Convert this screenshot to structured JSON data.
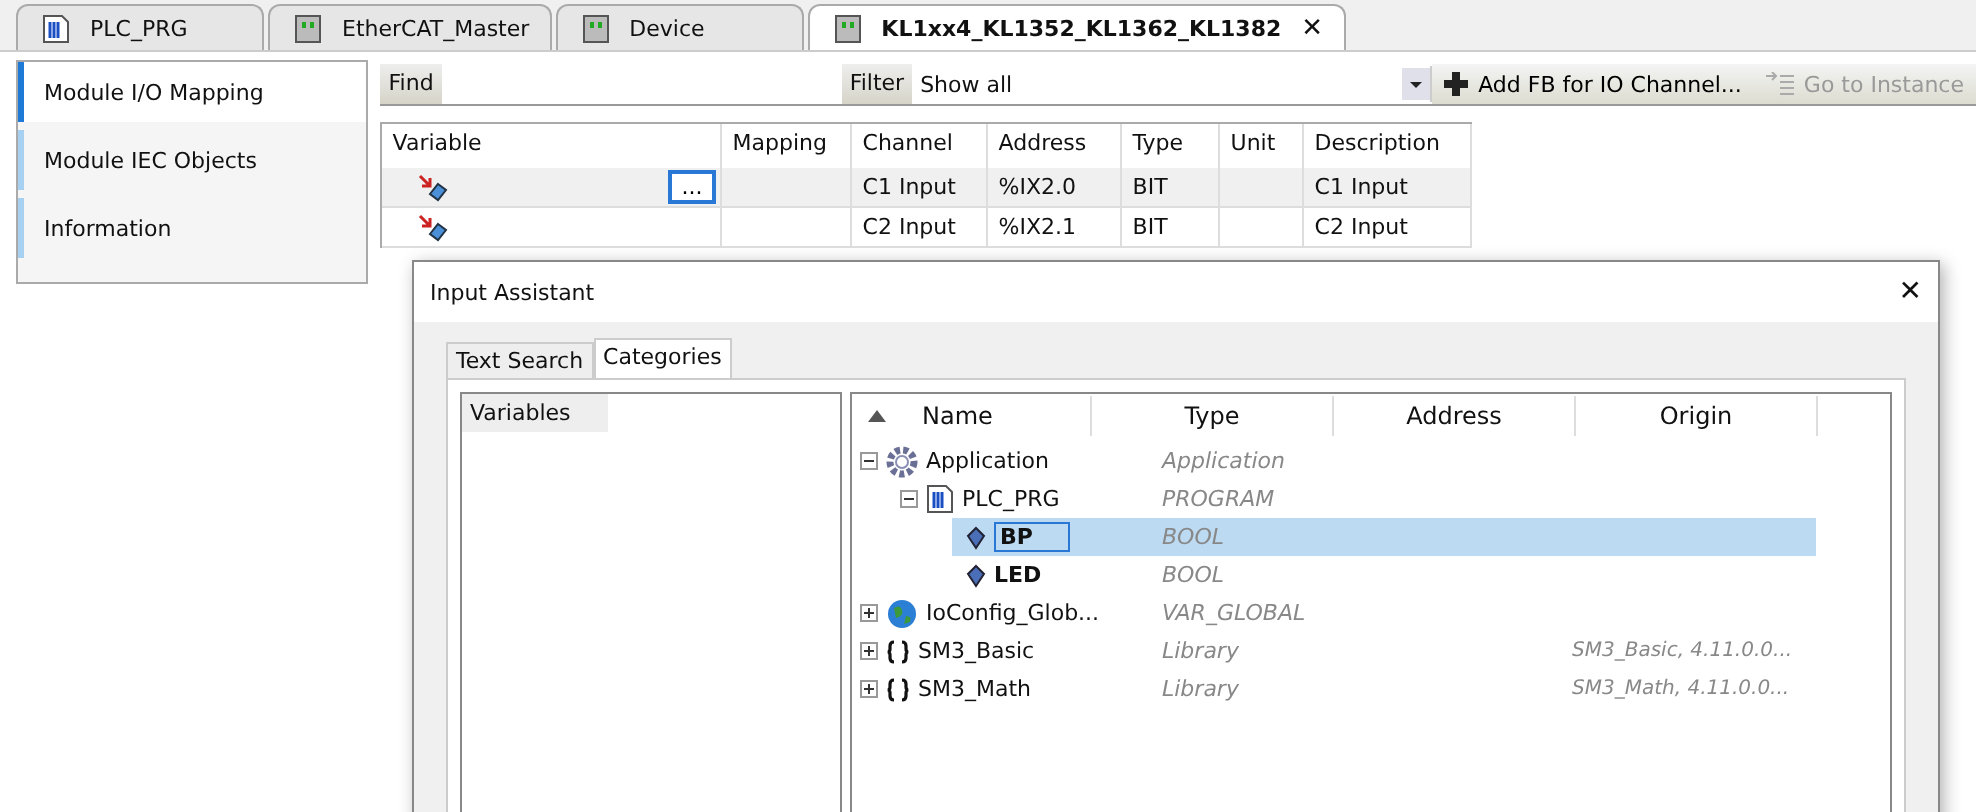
{
  "editor_tabs": [
    {
      "label": "PLC_PRG",
      "kind": "program",
      "selected": false,
      "closable": false
    },
    {
      "label": "EtherCAT_Master",
      "kind": "device",
      "selected": false,
      "closable": false
    },
    {
      "label": "Device",
      "kind": "device",
      "selected": false,
      "closable": false
    },
    {
      "label": "KL1xx4_KL1352_KL1362_KL1382",
      "kind": "device",
      "selected": true,
      "closable": true,
      "close_glyph": "✕"
    }
  ],
  "side_tabs": [
    {
      "label": "Module I/O Mapping",
      "selected": true
    },
    {
      "label": "Module IEC Objects",
      "selected": false
    },
    {
      "label": "Information",
      "selected": false
    }
  ],
  "toolbar": {
    "find_label": "Find",
    "filter_label": "Filter",
    "filter_value": "Show all",
    "add_button": "Add FB for IO Channel...",
    "goto_button": "Go to Instance"
  },
  "mapping_table": {
    "columns": [
      "Variable",
      "Mapping",
      "Channel",
      "Address",
      "Type",
      "Unit",
      "Description"
    ],
    "rows": [
      {
        "browse_button": "...",
        "channel": "C1 Input",
        "address": "%IX2.0",
        "type": "BIT",
        "description": "C1 Input"
      },
      {
        "channel": "C2 Input",
        "address": "%IX2.1",
        "type": "BIT",
        "description": "C2 Input"
      }
    ]
  },
  "dialog": {
    "title": "Input Assistant",
    "close_glyph": "✕",
    "tabs": [
      {
        "label": "Text Search",
        "selected": false
      },
      {
        "label": "Categories",
        "selected": true
      }
    ],
    "categories": [
      {
        "label": "Variables",
        "selected": true
      }
    ],
    "tree_columns": [
      "Name",
      "Type",
      "Address",
      "Origin"
    ],
    "tree": [
      {
        "name": "Application",
        "kind": "application",
        "type": "Application",
        "expanded": true,
        "selected": false,
        "children": [
          {
            "name": "PLC_PRG",
            "kind": "program",
            "type": "PROGRAM",
            "expanded": true,
            "selected": false,
            "children": [
              {
                "name": "BP",
                "kind": "variable",
                "type": "BOOL",
                "selected": true
              },
              {
                "name": "LED",
                "kind": "variable",
                "type": "BOOL",
                "selected": false
              }
            ]
          }
        ]
      },
      {
        "name": "IoConfig_Glob...",
        "kind": "globals",
        "type": "VAR_GLOBAL",
        "expanded": false,
        "selected": false
      },
      {
        "name": "SM3_Basic",
        "kind": "library",
        "type": "Library",
        "origin": "SM3_Basic, 4.11.0.0...",
        "expanded": false,
        "selected": false
      },
      {
        "name": "SM3_Math",
        "kind": "library",
        "type": "Library",
        "origin": "SM3_Math, 4.11.0.0...",
        "expanded": false,
        "selected": false
      }
    ]
  }
}
